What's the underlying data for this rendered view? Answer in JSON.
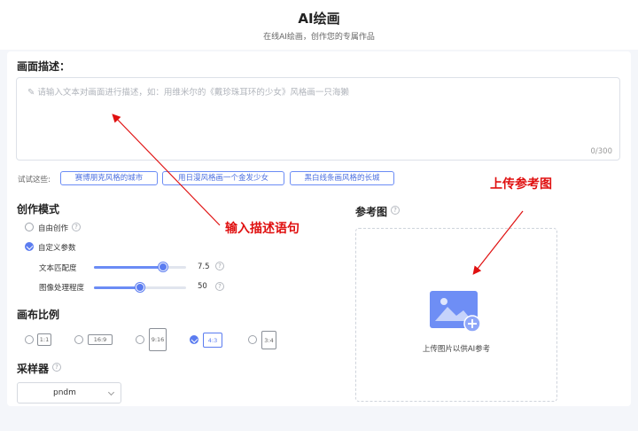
{
  "header": {
    "title": "AI绘画",
    "subtitle": "在线AI绘画，创作您的专属作品"
  },
  "description": {
    "label": "画面描述：",
    "placeholder": "请输入文本对画面进行描述，如：用维米尔的《戴珍珠耳环的少女》风格画一只海獭",
    "counter": "0/300"
  },
  "try_prompts": {
    "label": "试试这些:",
    "items": [
      "赛博朋克风格的城市",
      "用日漫风格画一个金发少女",
      "黑白线条画风格的长城"
    ]
  },
  "mode": {
    "label": "创作模式",
    "options": [
      {
        "label": "自由创作",
        "checked": false
      },
      {
        "label": "自定义参数",
        "checked": true
      }
    ],
    "sliders": [
      {
        "label": "文本匹配度",
        "value": "7.5",
        "fraction": 0.75
      },
      {
        "label": "图像处理程度",
        "value": "50",
        "fraction": 0.5
      }
    ]
  },
  "canvas_ratio": {
    "label": "画布比例",
    "options": [
      {
        "label": "1:1",
        "checked": false
      },
      {
        "label": "16:9",
        "checked": false
      },
      {
        "label": "9:16",
        "checked": false
      },
      {
        "label": "4:3",
        "checked": true
      },
      {
        "label": "3:4",
        "checked": false
      }
    ]
  },
  "sampler": {
    "label": "采样器",
    "value": "pndm"
  },
  "reference": {
    "label": "参考图",
    "upload_text": "上传图片以供AI参考"
  },
  "annotations": {
    "input_hint": "输入描述语句",
    "upload_hint": "上传参考图"
  },
  "colors": {
    "accent": "#5b7cf0",
    "annotation": "#e01010"
  }
}
